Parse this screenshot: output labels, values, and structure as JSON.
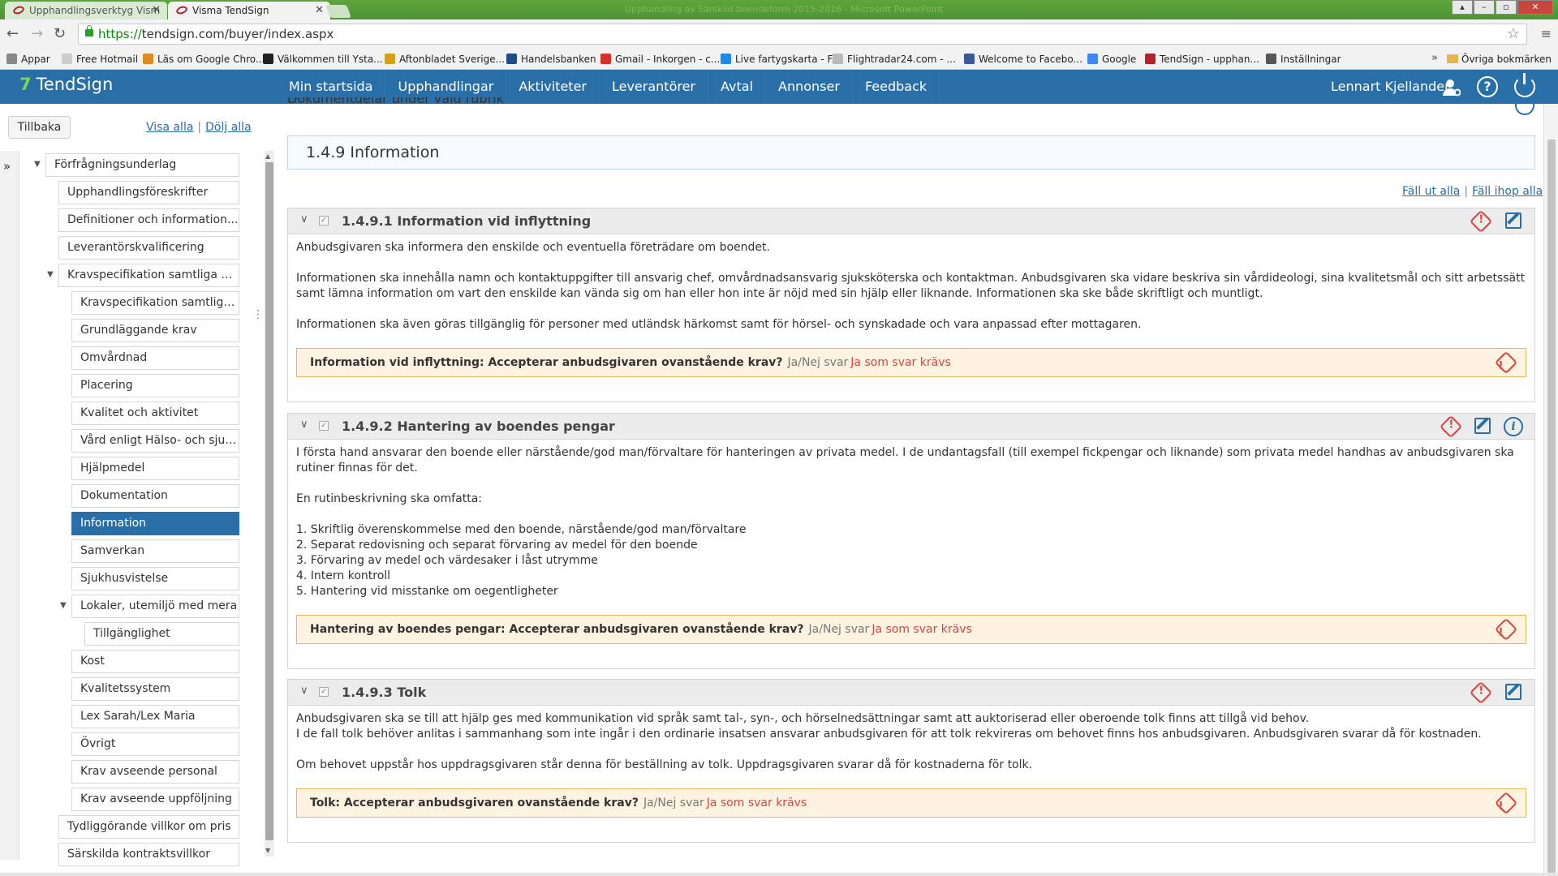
{
  "browser": {
    "tabs": [
      {
        "label": "Upphandlingsverktyg Vism",
        "active": false
      },
      {
        "label": "Visma TendSign",
        "active": true
      }
    ],
    "window_title": "Upphandling av Särskild boendeform 2015-2016 - Microsoft PowerPoint",
    "url_scheme": "https://",
    "url_rest": "tendsign.com/buyer/index.aspx",
    "bookmarks": [
      {
        "label": "Appar",
        "color": "#888888"
      },
      {
        "label": "Free Hotmail",
        "color": "#cccccc"
      },
      {
        "label": "Läs om Google Chro...",
        "color": "#dd8a1e"
      },
      {
        "label": "Välkommen till Ysta...",
        "color": "#222222"
      },
      {
        "label": "Aftonbladet Sverige...",
        "color": "#d4a017"
      },
      {
        "label": "Handelsbanken",
        "color": "#1f4d8a"
      },
      {
        "label": "Gmail - Inkorgen - c...",
        "color": "#d93025"
      },
      {
        "label": "Live fartygskarta - F...",
        "color": "#1e88e5"
      },
      {
        "label": "Flightradar24.com - ...",
        "color": "#bbbbbb"
      },
      {
        "label": "Welcome to Facebo...",
        "color": "#3b5998"
      },
      {
        "label": "Google",
        "color": "#4285f4"
      },
      {
        "label": "TendSign - upphan...",
        "color": "#b2232e"
      },
      {
        "label": "Inställningar",
        "color": "#555555"
      }
    ],
    "bookmarks_chevron": "»",
    "other_bookmarks": "Övriga bokmärken"
  },
  "header": {
    "logo": "TendSign",
    "nav": [
      "Min startsida",
      "Upphandlingar",
      "Aktiviteter",
      "Leverantörer",
      "Avtal",
      "Annonser",
      "Feedback"
    ],
    "user_name": "Lennart Kjellander",
    "help_glyph": "?",
    "accent": "#2a6ea8"
  },
  "left": {
    "back_label": "Tillbaka",
    "show_all": "Visa alla",
    "separator": "|",
    "hide_all": "Dölj alla",
    "tree": [
      {
        "label": "Förfrågningsunderlag",
        "level": 0,
        "expanded": true
      },
      {
        "label": "Upphandlingsföreskrifter",
        "level": 1
      },
      {
        "label": "Definitioner och information...",
        "level": 1
      },
      {
        "label": "Leverantörskvalificering",
        "level": 1
      },
      {
        "label": "Kravspecifikation samtliga de...",
        "level": 1,
        "expanded": true
      },
      {
        "label": "Kravspecifikation samtliga ...",
        "level": 2
      },
      {
        "label": "Grundläggande krav",
        "level": 2
      },
      {
        "label": "Omvårdnad",
        "level": 2
      },
      {
        "label": "Placering",
        "level": 2
      },
      {
        "label": "Kvalitet och aktivitet",
        "level": 2
      },
      {
        "label": "Vård enligt Hälso- och sjuk...",
        "level": 2
      },
      {
        "label": "Hjälpmedel",
        "level": 2
      },
      {
        "label": "Dokumentation",
        "level": 2
      },
      {
        "label": "Information",
        "level": 2,
        "selected": true
      },
      {
        "label": "Samverkan",
        "level": 2
      },
      {
        "label": "Sjukhusvistelse",
        "level": 2
      },
      {
        "label": "Lokaler, utemiljö med mera",
        "level": 2,
        "expanded": true
      },
      {
        "label": "Tillgänglighet",
        "level": 3
      },
      {
        "label": "Kost",
        "level": 2
      },
      {
        "label": "Kvalitetssystem",
        "level": 2
      },
      {
        "label": "Lex Sarah/Lex Maria",
        "level": 2
      },
      {
        "label": "Övrigt",
        "level": 2
      },
      {
        "label": "Krav avseende personal",
        "level": 2
      },
      {
        "label": "Krav avseende uppföljning",
        "level": 2
      },
      {
        "label": "Tydliggörande villkor om pris",
        "level": 1
      },
      {
        "label": "Särskilda kontraktsvillkor",
        "level": 1
      }
    ]
  },
  "main": {
    "cut_title": "Dokumentdelar under vald rubrik",
    "section_title": "1.4.9 Information",
    "expand_all": "Fäll ut alla",
    "collapse_all": "Fäll ihop alla",
    "requirements": [
      {
        "title": "1.4.9.1 Information vid inflyttning",
        "has_info": false,
        "blocks": [
          {
            "type": "p",
            "text": "Anbudsgivaren ska informera den enskilde och eventuella företrädare om boendet."
          },
          {
            "type": "p",
            "text": "Informationen ska innehålla namn och kontaktuppgifter till ansvarig chef, omvårdnadsansvarig sjuksköterska och kontaktman. Anbudsgivaren ska vidare beskriva sin vårdideologi, sina kvalitetsmål och sitt arbetssätt samt lämna information om vart den enskilde kan vända sig om han eller hon inte är nöjd med sin hjälp eller liknande. Informationen ska ske både skriftligt och muntligt."
          },
          {
            "type": "p",
            "text": "Informationen ska även göras tillgänglig för personer med utländsk härkomst samt för hörsel- och synskadade och vara anpassad efter mottagaren."
          }
        ],
        "question": "Information vid inflyttning: Accepterar anbudsgivaren ovanstående krav?",
        "answer_type": "Ja/Nej svar",
        "mandatory": "Ja som svar krävs"
      },
      {
        "title": "1.4.9.2 Hantering av boendes pengar",
        "has_info": true,
        "blocks": [
          {
            "type": "p",
            "text": "I första hand ansvarar den boende eller närstående/god man/förvaltare för hanteringen av privata medel. I de undantagsfall (till exempel fickpengar och liknande) som privata medel handhas av anbudsgivaren ska rutiner finnas för det."
          },
          {
            "type": "p",
            "text": "En rutinbeskrivning ska omfatta:"
          },
          {
            "type": "list",
            "items": [
              "1. Skriftlig överenskommelse med den boende, närstående/god man/förvaltare",
              "2. Separat redovisning och separat förvaring av medel för den boende",
              "3. Förvaring av medel och värdesaker i låst utrymme",
              "4. Intern kontroll",
              "5. Hantering vid misstanke om oegentligheter"
            ]
          }
        ],
        "question": "Hantering av boendes pengar: Accepterar anbudsgivaren ovanstående krav?",
        "answer_type": "Ja/Nej svar",
        "mandatory": "Ja som svar krävs"
      },
      {
        "title": "1.4.9.3 Tolk",
        "has_info": false,
        "blocks": [
          {
            "type": "tight",
            "text": "Anbudsgivaren ska se till att hjälp ges med kommunikation vid språk samt tal-, syn-, och hörselnedsättningar samt att auktoriserad eller oberoende tolk finns att tillgå vid behov."
          },
          {
            "type": "p",
            "text": "I de fall tolk behöver anlitas i sammanhang som inte ingår i den ordinarie insatsen ansvarar anbudsgivaren för att tolk rekvireras om behovet finns hos anbudsgivaren.  Anbudsgivaren svarar då för kostnaden."
          },
          {
            "type": "p",
            "text": "Om behovet uppstår hos uppdragsgivaren står denna för beställning av tolk. Uppdragsgivaren svarar då för kostnaderna för tolk."
          }
        ],
        "question": "Tolk: Accepterar anbudsgivaren ovanstående krav?",
        "answer_type": "Ja/Nej svar",
        "mandatory": "Ja som svar krävs"
      }
    ]
  }
}
